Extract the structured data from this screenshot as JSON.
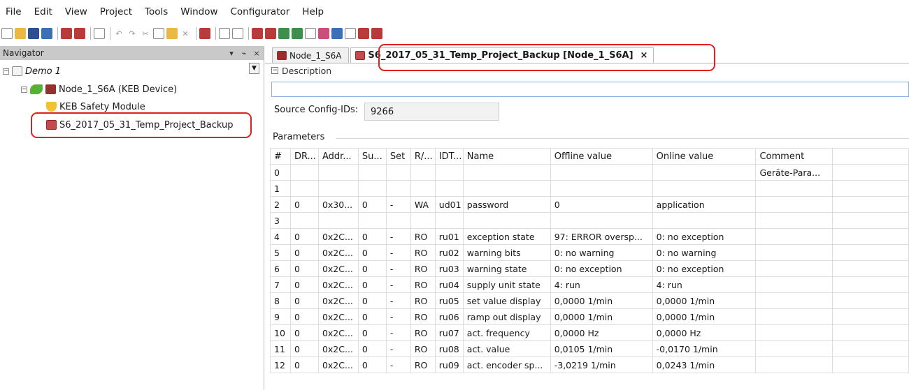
{
  "menu": [
    "File",
    "Edit",
    "View",
    "Project",
    "Tools",
    "Window",
    "Configurator",
    "Help"
  ],
  "toolbar": {
    "icons": [
      "new-document-icon",
      "open-folder-icon",
      "save-icon",
      "save-all-icon",
      "keb-device-icon",
      "keb-export-icon",
      "print-icon",
      "undo-icon",
      "redo-icon",
      "cut-icon",
      "copy-icon",
      "paste-icon",
      "delete-icon",
      "keb-project-icon",
      "add-dropdown-icon",
      "new-item-icon",
      "download-icon",
      "upload-icon",
      "read-device-icon",
      "write-device-icon",
      "compare-icon",
      "wrench-icon",
      "library-icon",
      "chart-icon",
      "keb-config-icon",
      "keb-tool-icon"
    ]
  },
  "navigator": {
    "title": "Navigator",
    "controls": [
      "▾",
      "⌁",
      "×"
    ],
    "tree": [
      {
        "label": "Demo 1",
        "level": 0
      },
      {
        "label": "Node_1_S6A (KEB Device)",
        "level": 1
      },
      {
        "label": "KEB Safety Module",
        "level": 2
      },
      {
        "label": "S6_2017_05_31_Temp_Project_Backup",
        "level": 2
      }
    ]
  },
  "tabs": [
    {
      "label": "Node_1_S6A",
      "active": false
    },
    {
      "label": "S6_2017_05_31_Temp_Project_Backup [Node_1_S6A]",
      "active": true,
      "close": "×"
    }
  ],
  "description": {
    "label": "Description",
    "value": ""
  },
  "source": {
    "label": "Source Config-IDs:",
    "value": "9266"
  },
  "parameters": {
    "label": "Parameters",
    "columns": [
      "#",
      "DR...",
      "Addr...",
      "Su...",
      "Set",
      "R/...",
      "IDT...",
      "Name",
      "Offline value",
      "Online value",
      "Comment"
    ],
    "rows": [
      [
        "0",
        "",
        "",
        "",
        "",
        "",
        "",
        "",
        "",
        "",
        "Geräte-Para..."
      ],
      [
        "1",
        "",
        "",
        "",
        "",
        "",
        "",
        "",
        "",
        "",
        ""
      ],
      [
        "2",
        "0",
        "0x30...",
        "0",
        "-",
        "WA",
        "ud01",
        "password",
        "0",
        "application",
        ""
      ],
      [
        "3",
        "",
        "",
        "",
        "",
        "",
        "",
        "",
        "",
        "",
        ""
      ],
      [
        "4",
        "0",
        "0x2C...",
        "0",
        "-",
        "RO",
        "ru01",
        "exception state",
        "97: ERROR oversp...",
        "0: no exception",
        ""
      ],
      [
        "5",
        "0",
        "0x2C...",
        "0",
        "-",
        "RO",
        "ru02",
        "warning bits",
        "0: no warning",
        "0: no warning",
        ""
      ],
      [
        "6",
        "0",
        "0x2C...",
        "0",
        "-",
        "RO",
        "ru03",
        "warning state",
        "0: no exception",
        "0: no exception",
        ""
      ],
      [
        "7",
        "0",
        "0x2C...",
        "0",
        "-",
        "RO",
        "ru04",
        "supply unit state",
        "4: run",
        "4: run",
        ""
      ],
      [
        "8",
        "0",
        "0x2C...",
        "0",
        "-",
        "RO",
        "ru05",
        "set value display",
        "0,0000 1/min",
        "0,0000 1/min",
        ""
      ],
      [
        "9",
        "0",
        "0x2C...",
        "0",
        "-",
        "RO",
        "ru06",
        "ramp out display",
        "0,0000 1/min",
        "0,0000 1/min",
        ""
      ],
      [
        "10",
        "0",
        "0x2C...",
        "0",
        "-",
        "RO",
        "ru07",
        "act. frequency",
        "0,0000 Hz",
        "0,0000 Hz",
        ""
      ],
      [
        "11",
        "0",
        "0x2C...",
        "0",
        "-",
        "RO",
        "ru08",
        "act. value",
        "0,0105 1/min",
        "-0,0170 1/min",
        ""
      ],
      [
        "12",
        "0",
        "0x2C...",
        "0",
        "-",
        "RO",
        "ru09",
        "act. encoder sp...",
        "-3,0219 1/min",
        "0,0243 1/min",
        ""
      ]
    ]
  },
  "colors": {
    "highlight": "#e0201c",
    "header_bar": "#c9c9c9",
    "input_border": "#8bb0d6"
  }
}
